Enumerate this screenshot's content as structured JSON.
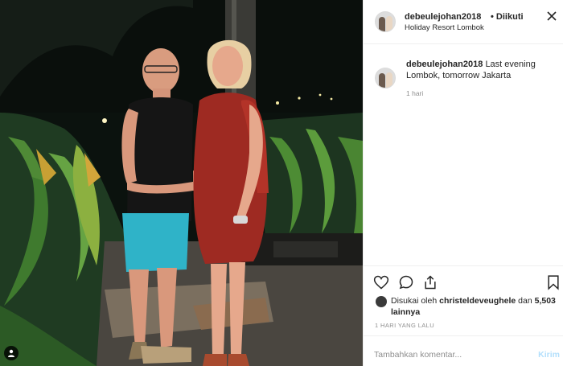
{
  "post": {
    "username": "debeulejohan2018",
    "separator": "•",
    "follow_label": "Diikuti",
    "location": "Holiday Resort Lombok",
    "caption": "Last evening Lombok, tomorrow Jakarta",
    "time_ago": "1 hari",
    "liked_prefix": "Disukai oleh",
    "liked_user": "christeldeveughele",
    "liked_and": "dan",
    "liked_count": "5,503 lainnya",
    "date_label": "1 HARI YANG LALU",
    "comment_placeholder": "Tambahkan komentar...",
    "send_label": "Kirim"
  },
  "icons": {
    "close": "close-icon",
    "like": "heart-icon",
    "comment": "comment-icon",
    "share": "share-icon",
    "save": "bookmark-icon",
    "user_tag": "user-tag-icon"
  },
  "colors": {
    "text": "#262626",
    "muted": "#8e8e8e",
    "send_disabled": "#b2dffc",
    "border": "#efefef"
  }
}
